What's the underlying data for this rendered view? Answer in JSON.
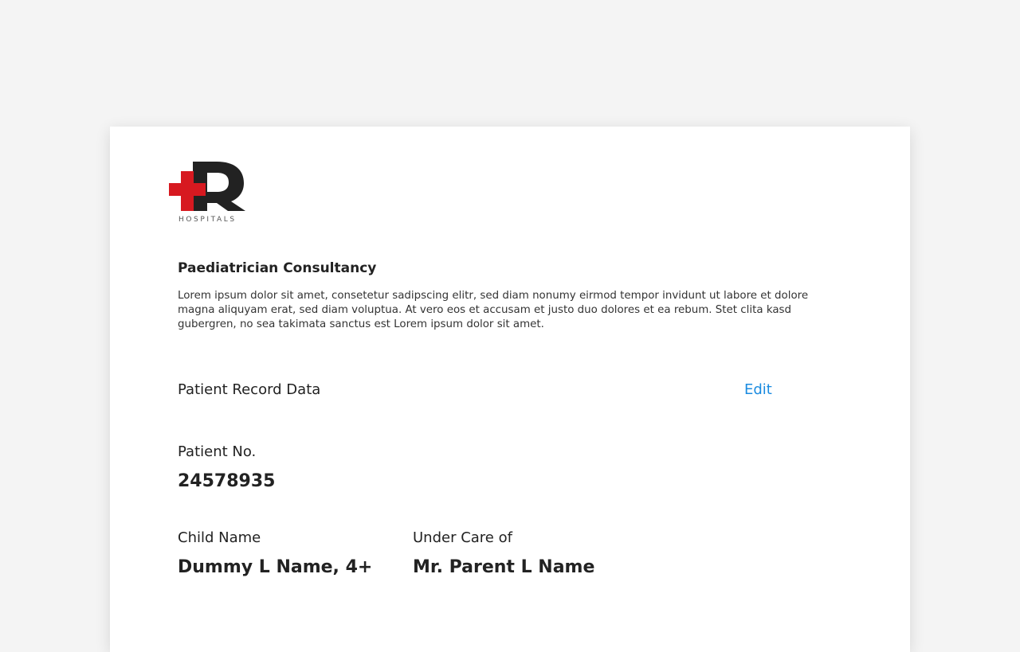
{
  "brand": {
    "logo_letter": "R",
    "logo_subtitle": "HOSPITALS",
    "colors": {
      "cross": "#d71920",
      "letter": "#222222"
    }
  },
  "consultancy": {
    "title": "Paediatrician Consultancy",
    "description": "Lorem ipsum dolor sit amet, consetetur sadipscing elitr, sed diam nonumy eirmod tempor invidunt ut labore et dolore magna aliquyam erat, sed diam voluptua. At vero eos et accusam et justo duo dolores et ea rebum. Stet clita kasd gubergren, no sea takimata sanctus est Lorem ipsum dolor sit amet."
  },
  "record": {
    "section_title": "Patient Record Data",
    "edit_label": "Edit",
    "edit_color": "#1a8be0",
    "patient_no_label": "Patient No.",
    "patient_no_value": "24578935",
    "child_name_label": "Child Name",
    "child_name_value": "Dummy L Name, 4+",
    "under_care_label": "Under Care of",
    "under_care_value": "Mr. Parent L Name"
  }
}
